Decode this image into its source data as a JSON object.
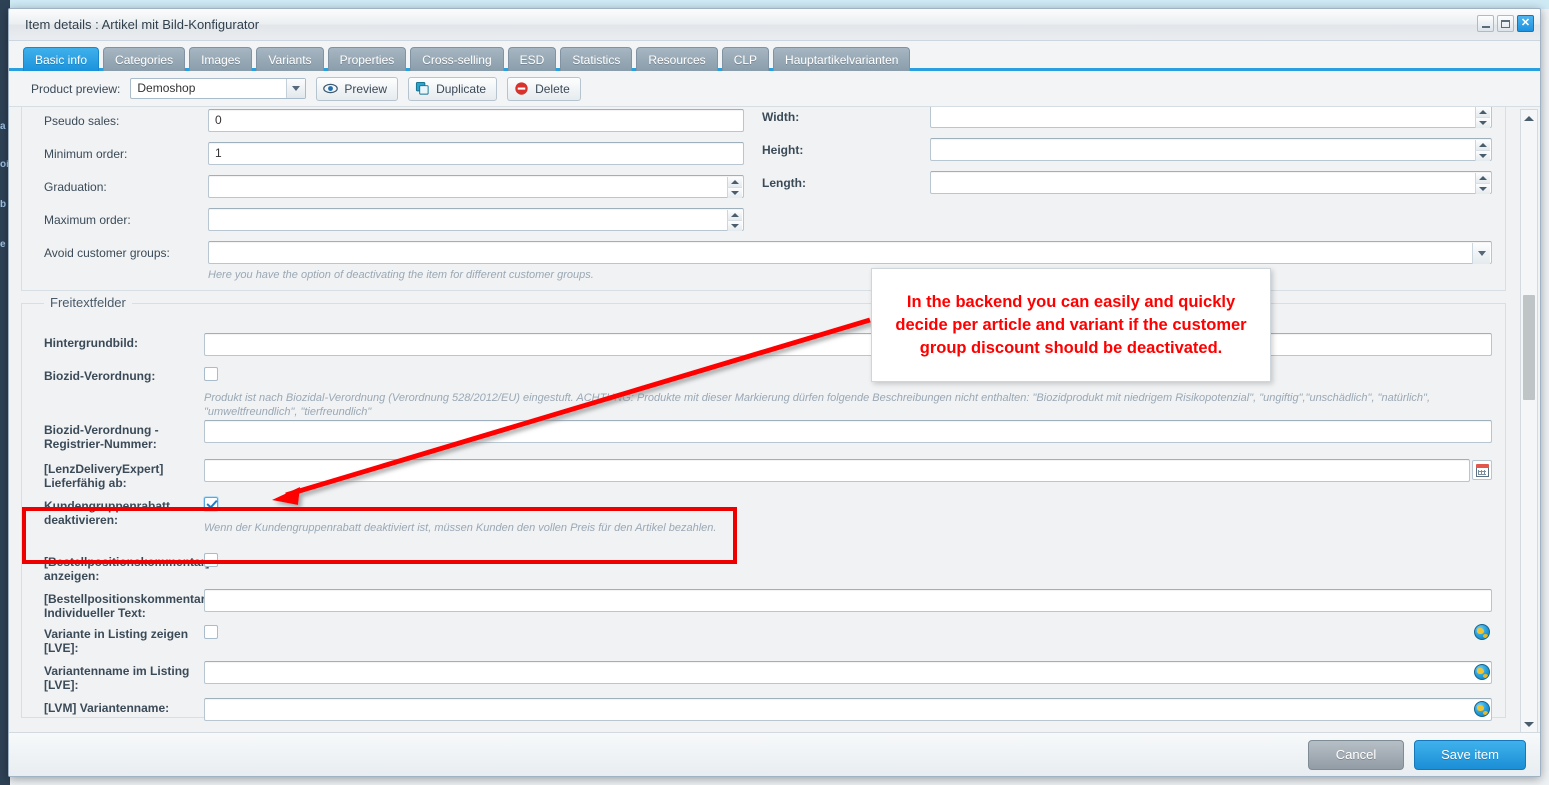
{
  "window": {
    "title": "Item details : Artikel mit Bild-Konfigurator",
    "minimize_label": "–",
    "maximize_label": "□",
    "close_label": "✕"
  },
  "background": {
    "rail_items": [
      "a",
      "oi",
      "b",
      "e"
    ]
  },
  "tabs": [
    {
      "label": "Basic info",
      "active": true
    },
    {
      "label": "Categories",
      "active": false
    },
    {
      "label": "Images",
      "active": false
    },
    {
      "label": "Variants",
      "active": false
    },
    {
      "label": "Properties",
      "active": false
    },
    {
      "label": "Cross-selling",
      "active": false
    },
    {
      "label": "ESD",
      "active": false
    },
    {
      "label": "Statistics",
      "active": false
    },
    {
      "label": "Resources",
      "active": false
    },
    {
      "label": "CLP",
      "active": false
    },
    {
      "label": "Hauptartikelvarianten",
      "active": false
    }
  ],
  "toolbar": {
    "product_preview_label": "Product preview:",
    "shop_value": "Demoshop",
    "preview_label": "Preview",
    "duplicate_label": "Duplicate",
    "delete_label": "Delete",
    "preview_icon": "eye-icon",
    "duplicate_icon": "copy-icon",
    "delete_icon": "minus-circle-icon"
  },
  "top_section": {
    "left_fields": [
      {
        "label": "Pseudo sales:",
        "value": "0",
        "spinner": true
      },
      {
        "label": "Minimum order:",
        "value": "1",
        "spinner": true
      },
      {
        "label": "Graduation:",
        "value": "",
        "spinner": true
      },
      {
        "label": "Maximum order:",
        "value": "",
        "spinner": true
      }
    ],
    "right_fields": [
      {
        "label": "Width:",
        "value": "",
        "spinner": true
      },
      {
        "label": "Height:",
        "value": "",
        "spinner": true
      },
      {
        "label": "Length:",
        "value": "",
        "spinner": true
      }
    ],
    "avoid_customer_groups": {
      "label": "Avoid customer groups:",
      "value": "",
      "hint": "Here you have the option of deactivating the item for different customer groups."
    }
  },
  "freetext": {
    "legend": "Freitextfelder",
    "fields": [
      {
        "name": "hintergrundbild",
        "label": "Hintergrundbild:",
        "type": "text",
        "value": ""
      },
      {
        "name": "biozid-verordnung",
        "label": "Biozid-Verordnung:",
        "type": "checkbox",
        "checked": false,
        "hint": "Produkt ist nach Biozidal-Verordnung (Verordnung 528/2012/EU) eingestuft. ACHTUNG: Produkte mit dieser Markierung dürfen folgende Beschreibungen nicht enthalten: \"Biozidprodukt mit niedrigem Risikopotenzial\", \"ungiftig\",\"unschädlich\", \"natürlich\", \"umweltfreundlich\", \"tierfreundlich\""
      },
      {
        "name": "biozid-registriernummer",
        "label": "Biozid-Verordnung -\nRegistrier-Nummer:",
        "type": "text",
        "value": ""
      },
      {
        "name": "lenzdeliveryexpert-lieferfaehig-ab",
        "label": "[LenzDeliveryExpert]\nLieferfähig ab:",
        "type": "date",
        "value": ""
      },
      {
        "name": "kundengruppenrabatt-deaktivieren",
        "label": "Kundengruppenrabatt\ndeaktivieren:",
        "type": "checkbox",
        "checked": true,
        "highlighted": true,
        "hint": "Wenn der Kundengruppenrabatt deaktiviert ist, müssen Kunden den vollen Preis für den Artikel bezahlen."
      },
      {
        "name": "bestellpositionskommentar-anzeigen",
        "label": "[Bestellpositionskommentar]\nanzeigen:",
        "type": "checkbox",
        "checked": false
      },
      {
        "name": "bestellpositionskommentar-individueller-text",
        "label": "[Bestellpositionskommentar]\nIndividueller Text:",
        "type": "text",
        "value": ""
      },
      {
        "name": "variante-in-listing-zeigen",
        "label": "Variante in Listing zeigen\n[LVE]:",
        "type": "checkbox",
        "checked": false,
        "globe": true
      },
      {
        "name": "variantenname-im-listing",
        "label": "Variantenname im Listing\n[LVE]:",
        "type": "text",
        "value": "",
        "globe": true
      },
      {
        "name": "lvm-variantenname",
        "label": "[LVM] Variantenname:",
        "type": "text",
        "value": "",
        "globe": true
      }
    ]
  },
  "footer": {
    "cancel_label": "Cancel",
    "save_label": "Save item"
  },
  "annotation": {
    "text": "In the backend you can easily and quickly decide per article and variant if the customer group discount should be deactivated.",
    "color": "#ff0000",
    "highlight_color": "#ee0000"
  },
  "colors": {
    "accent": "#1b8ed6",
    "tab_active": "#1a93dd",
    "tab_inactive": "#8a9dab",
    "annotation_red": "#ff0000",
    "page_bg": "#f0f2f4",
    "desktop_bg": "#cfeaf5"
  }
}
